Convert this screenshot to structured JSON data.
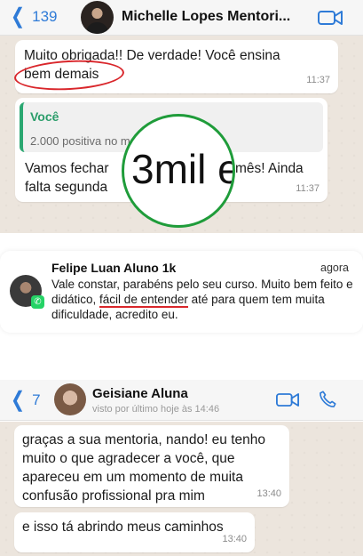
{
  "chat1": {
    "back_count": "139",
    "contact_name": "Michelle Lopes Mentori...",
    "messages": [
      {
        "text_line1": "Muito obrigada!! De verdade! Você ensina",
        "text_line2": "bem demais",
        "time": "11:37"
      },
      {
        "quote_author": "Você",
        "quote_text": "2.000 positiva no m",
        "text_line1": "Vamos fechar",
        "text_line1_end": "mês! Ainda",
        "text_line2": "falta segunda",
        "time": "11:37"
      }
    ],
    "highlight_text": "3mil e"
  },
  "notification": {
    "title": "Felipe Luan Aluno 1k",
    "time": "agora",
    "body_before": "Vale constar, parabéns pelo seu curso. Muito bem feito e didático, ",
    "body_highlight": "fácil de entender",
    "body_after": " até para quem tem muita dificuldade, acredito eu."
  },
  "chat2": {
    "back_count": "7",
    "contact_name": "Geisiane Aluna",
    "status": "visto por último hoje às 14:46",
    "messages": [
      {
        "text": "graças a sua mentoria, nando! eu tenho muito o que agradecer a você, que apareceu em um momento de muita confusão profissional pra mim",
        "time": "13:40"
      },
      {
        "text": "e isso tá abrindo meus caminhos",
        "time": "13:40"
      }
    ]
  },
  "colors": {
    "accent": "#2f7bd7",
    "highlight_red": "#d9262b",
    "highlight_green": "#1f9c3a",
    "whatsapp": "#25d366"
  },
  "icons": [
    "chevron-left-icon",
    "video-call-icon",
    "phone-icon",
    "whatsapp-icon"
  ]
}
